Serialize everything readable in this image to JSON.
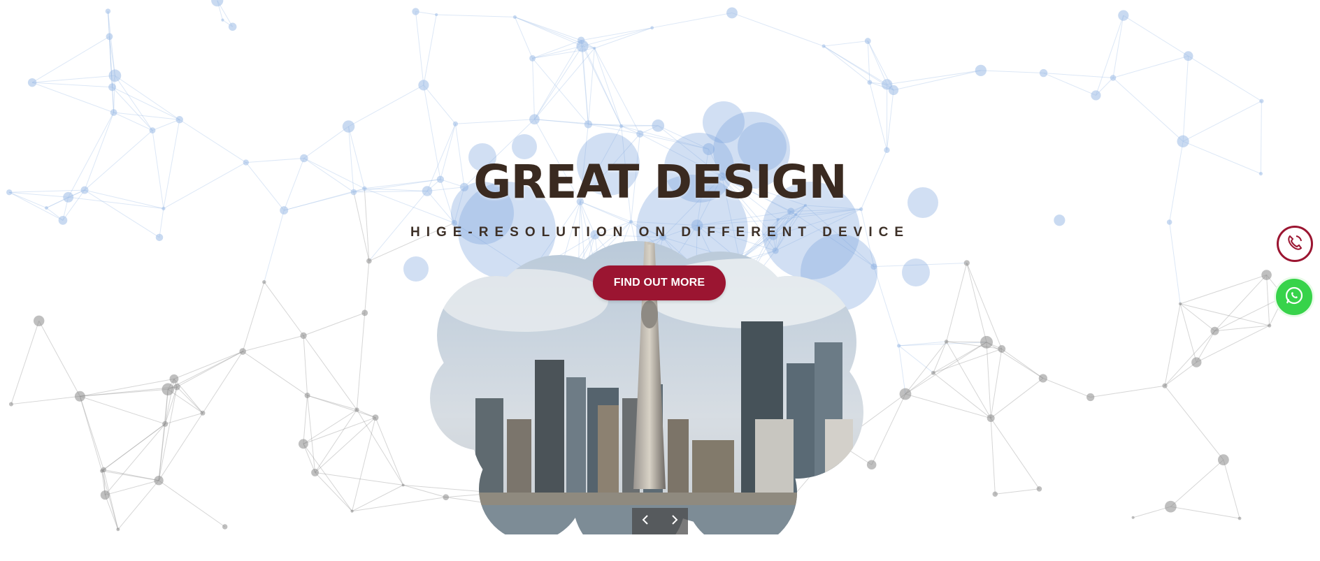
{
  "hero": {
    "title": "GREAT DESIGN",
    "subtitle": "HIGE-RESOLUTION ON DIFFERENT DEVICE",
    "cta_label": "FIND OUT MORE"
  },
  "slider": {
    "prev_icon": "chevron-left-icon",
    "next_icon": "chevron-right-icon"
  },
  "floating": {
    "phone_icon": "phone-icon",
    "whatsapp_icon": "whatsapp-icon"
  },
  "colors": {
    "accent": "#9b1531",
    "whatsapp": "#37d34a",
    "network_blue": "#9cbce6",
    "network_gray": "#8a8a8a",
    "title": "#3a2a20"
  }
}
